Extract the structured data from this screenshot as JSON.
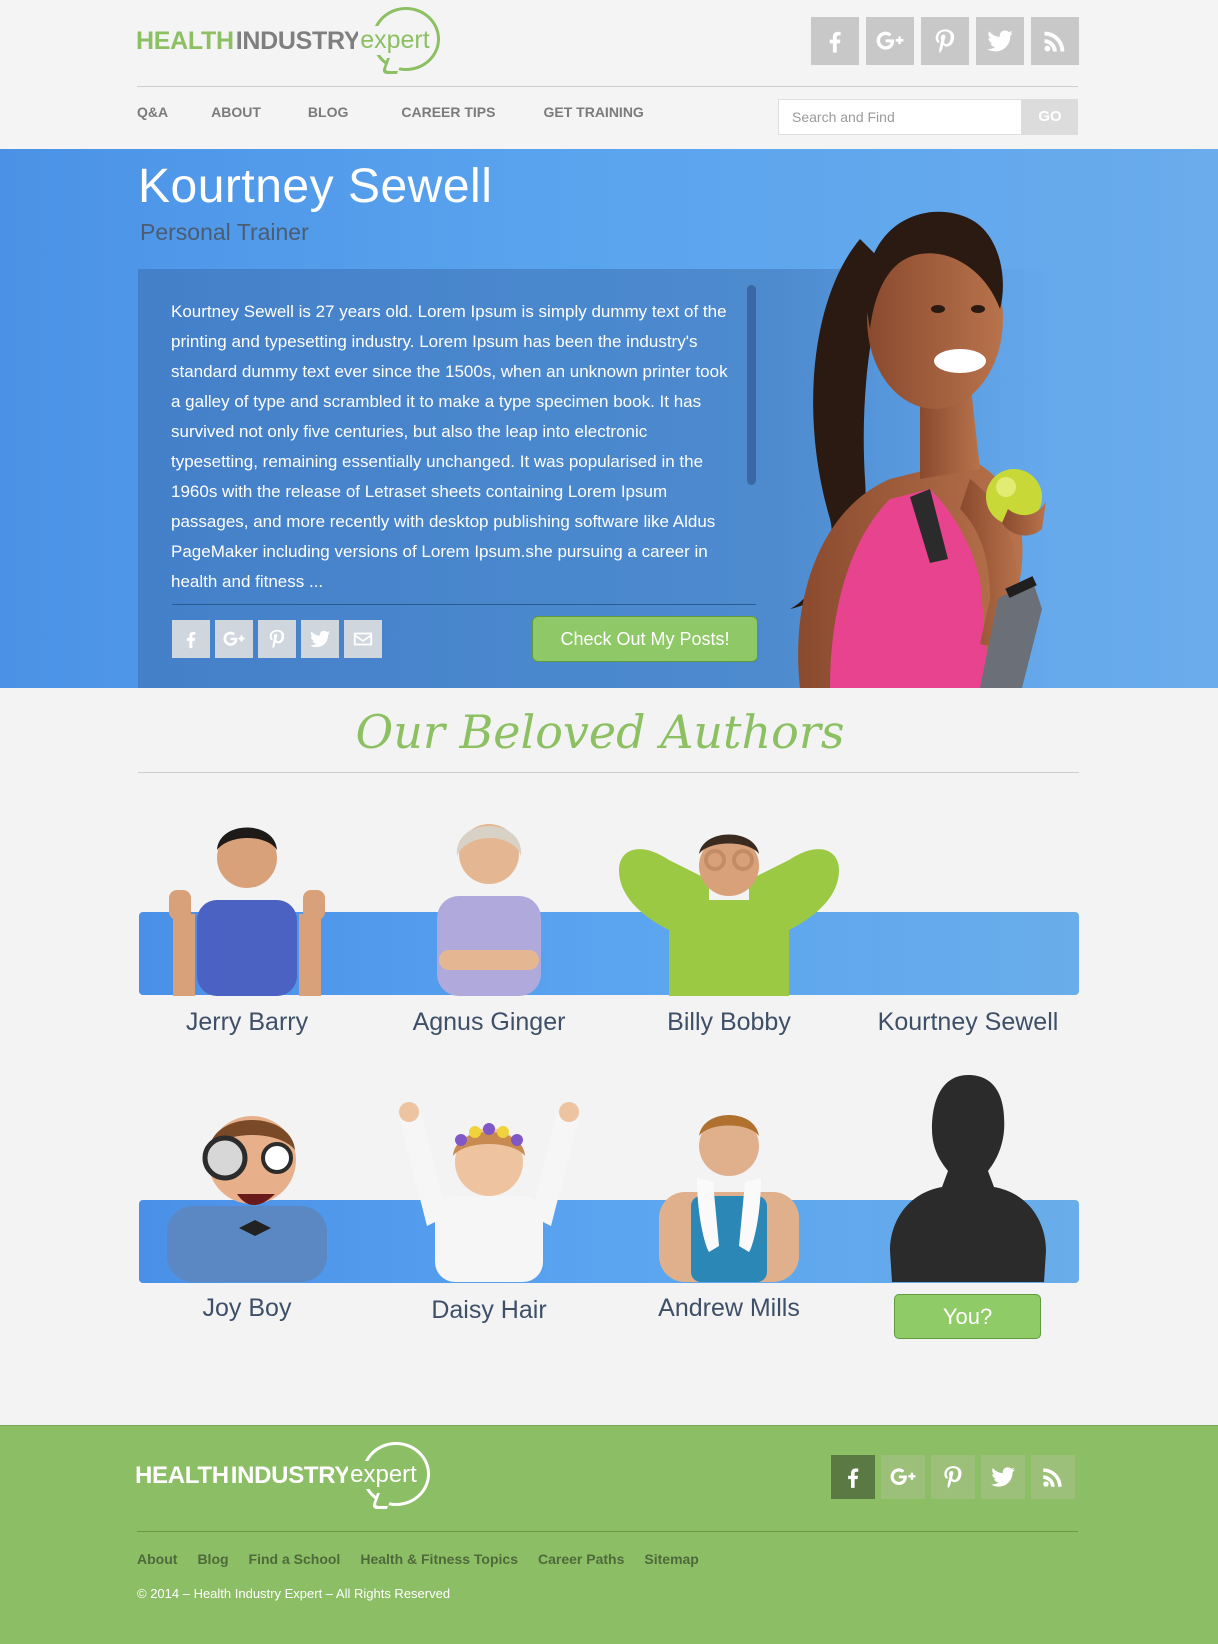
{
  "header": {
    "logo": {
      "word1": "HEALTH",
      "word2": "INDUSTRY",
      "word3": "expert"
    },
    "social": [
      "facebook-icon",
      "google-plus-icon",
      "pinterest-icon",
      "twitter-icon",
      "rss-icon"
    ],
    "nav": [
      "Q&A",
      "ABOUT",
      "BLOG",
      "CAREER TIPS",
      "GET TRAINING"
    ],
    "search": {
      "placeholder": "Search and Find",
      "button": "GO"
    }
  },
  "hero": {
    "name": "Kourtney Sewell",
    "role": "Personal Trainer",
    "bio": "Kourtney Sewell is 27 years old. Lorem Ipsum is simply dummy text of the printing and typesetting industry. Lorem Ipsum has been the industry's standard dummy text ever since the 1500s, when an unknown printer took a galley of type and scrambled it to make a type specimen book. It has survived not only five centuries, but also the leap into electronic typesetting, remaining essentially unchanged. It was popularised in the 1960s with the release of Letraset sheets containing Lorem Ipsum passages, and more recently with desktop publishing software like Aldus PageMaker including versions of Lorem Ipsum.she pursuing a career in health and fitness ...",
    "share": [
      "facebook-icon",
      "google-plus-icon",
      "pinterest-icon",
      "twitter-icon",
      "mail-icon"
    ],
    "posts_button": "Check Out My Posts!"
  },
  "authors": {
    "title": "Our Beloved Authors",
    "row1": [
      "Jerry Barry",
      "Agnus Ginger",
      "Billy Bobby",
      "Kourtney Sewell"
    ],
    "row2": [
      "Joy Boy",
      "Daisy Hair",
      "Andrew Mills"
    ],
    "you_button": "You?"
  },
  "footer": {
    "logo": {
      "word1": "HEALTH",
      "word2": "INDUSTRY",
      "word3": "expert"
    },
    "social": [
      "facebook-icon",
      "google-plus-icon",
      "pinterest-icon",
      "twitter-icon",
      "rss-icon"
    ],
    "links": [
      "About",
      "Blog",
      "Find a School",
      "Health & Fitness Topics",
      "Career Paths",
      "Sitemap"
    ],
    "copyright": "© 2014 – Health Industry Expert – All Rights Reserved"
  },
  "colors": {
    "brand_green": "#8cc063",
    "hero_blue": "#59a3ee",
    "nav_gray": "#7b7b7b"
  }
}
